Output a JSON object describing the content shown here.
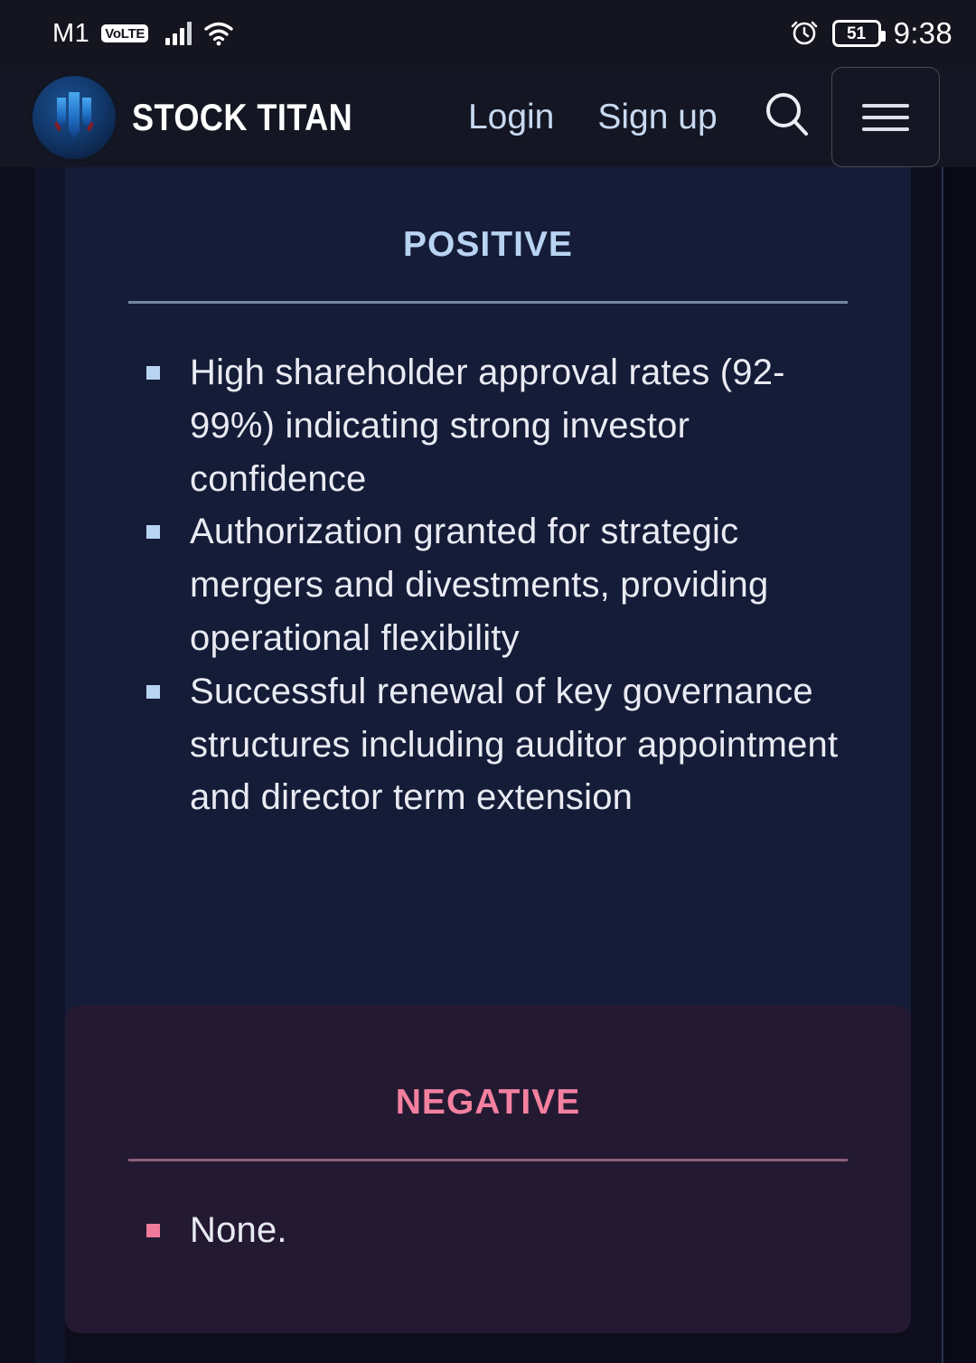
{
  "statusbar": {
    "carrier": "M1",
    "volte_badge": "VoLTE",
    "battery_level": "51",
    "time": "9:38",
    "icons": [
      "signal-bars-icon",
      "wifi-icon",
      "alarm-clock-icon",
      "battery-icon"
    ]
  },
  "header": {
    "brand": "STOCK TITAN",
    "logo_icon": "stock-titan-logo",
    "nav": [
      {
        "label": "Login"
      },
      {
        "label": "Sign up"
      }
    ],
    "search_icon": "search-icon",
    "menu_icon": "hamburger-menu-icon"
  },
  "content": {
    "cards": [
      {
        "title": "Positive",
        "accent": "#b9d4f2",
        "bullet_color": "#b8d4f0",
        "divider_color": "#76869f",
        "background": "#151c38",
        "items": [
          "High shareholder approval rates (92-99%) indicating strong investor confidence",
          "Authorization granted for strategic mergers and divestments, providing operational flexibility",
          "Successful renewal of key governance structures including auditor appointment and director term extension"
        ]
      },
      {
        "title": "Negative",
        "accent": "#f4809f",
        "bullet_color": "#ef7b9c",
        "divider_color": "#8d6178",
        "background": "#231a32",
        "items": [
          "None."
        ]
      }
    ]
  }
}
